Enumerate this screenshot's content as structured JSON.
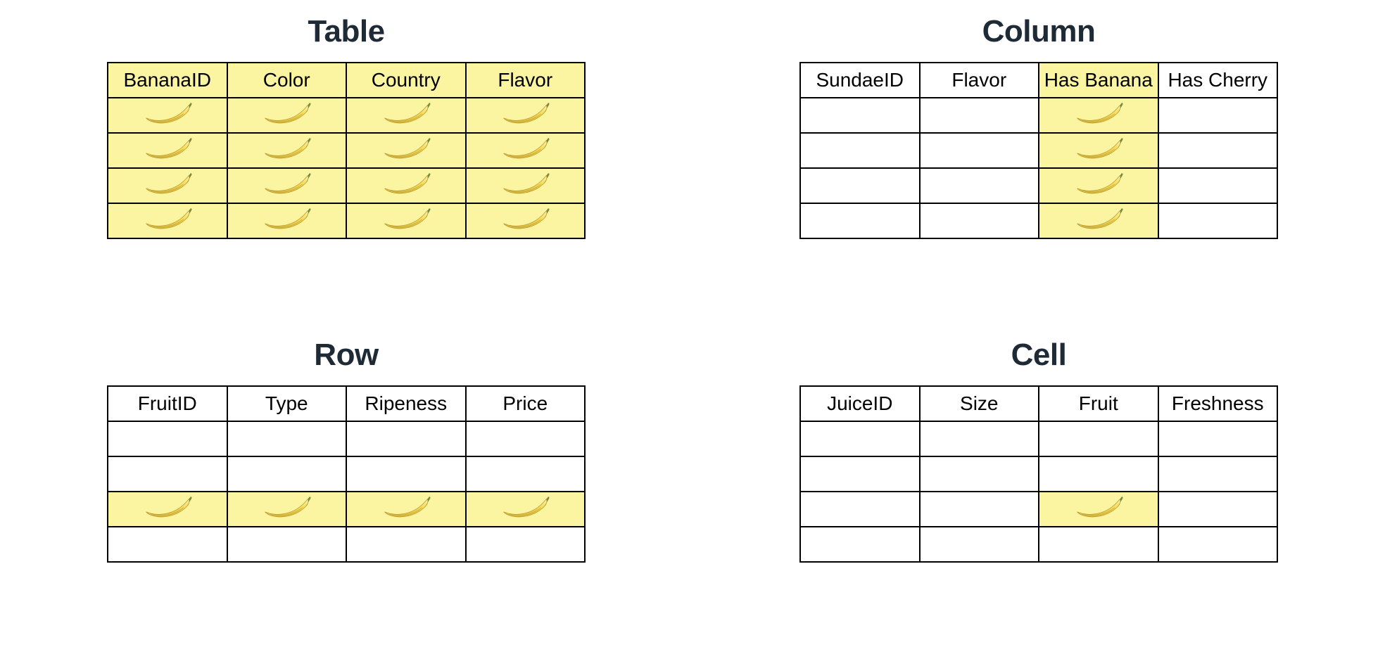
{
  "highlight_color": "#fbf4a0",
  "icon": "banana",
  "panels": [
    {
      "id": "table",
      "title": "Table",
      "columns": [
        "BananaID",
        "Color",
        "Country",
        "Flavor"
      ],
      "rows": 4,
      "highlight": {
        "kind": "table"
      }
    },
    {
      "id": "column",
      "title": "Column",
      "columns": [
        "SundaeID",
        "Flavor",
        "Has Banana",
        "Has Cherry"
      ],
      "rows": 4,
      "highlight": {
        "kind": "column",
        "col": 2
      }
    },
    {
      "id": "row",
      "title": "Row",
      "columns": [
        "FruitID",
        "Type",
        "Ripeness",
        "Price"
      ],
      "rows": 4,
      "highlight": {
        "kind": "row",
        "row": 2
      }
    },
    {
      "id": "cell",
      "title": "Cell",
      "columns": [
        "JuiceID",
        "Size",
        "Fruit",
        "Freshness"
      ],
      "rows": 4,
      "highlight": {
        "kind": "cell",
        "row": 2,
        "col": 2
      }
    }
  ]
}
